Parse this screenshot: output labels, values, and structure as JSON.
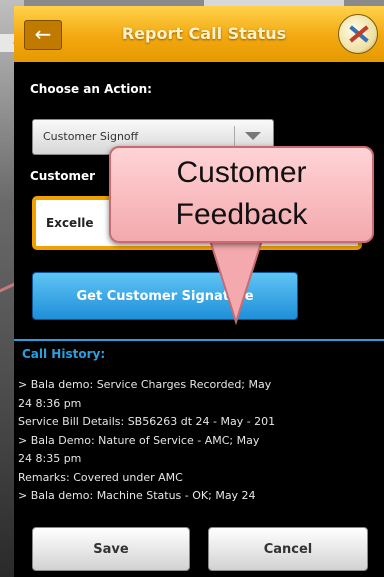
{
  "background_left_text": "ce",
  "titlebar": {
    "title": "Report Call Status",
    "back_icon": "arrow-left-icon"
  },
  "action": {
    "label": "Choose an Action:",
    "selected": "Customer Signoff"
  },
  "feedback": {
    "label": "Customer",
    "selected": "Excelle"
  },
  "signature_button": "Get Customer Signature",
  "callout": {
    "line1": "Customer",
    "line2": "Feedback"
  },
  "call_history": {
    "title": "Call History:",
    "lines": [
      "> Bala demo: Service Charges Recorded; May",
      "24 8:36 pm",
      "Service Bill Details: SB56263 dt 24 - May - 201",
      "> Bala Demo: Nature of Service - AMC; May",
      "24 8:35 pm",
      "Remarks: Covered under AMC",
      "> Bala demo: Machine Status - OK; May 24"
    ]
  },
  "buttons": {
    "save": "Save",
    "cancel": "Cancel"
  },
  "colors": {
    "titlebar": "#f3a811",
    "accent": "#2aa0e0",
    "callout": "#f3a9ad"
  }
}
